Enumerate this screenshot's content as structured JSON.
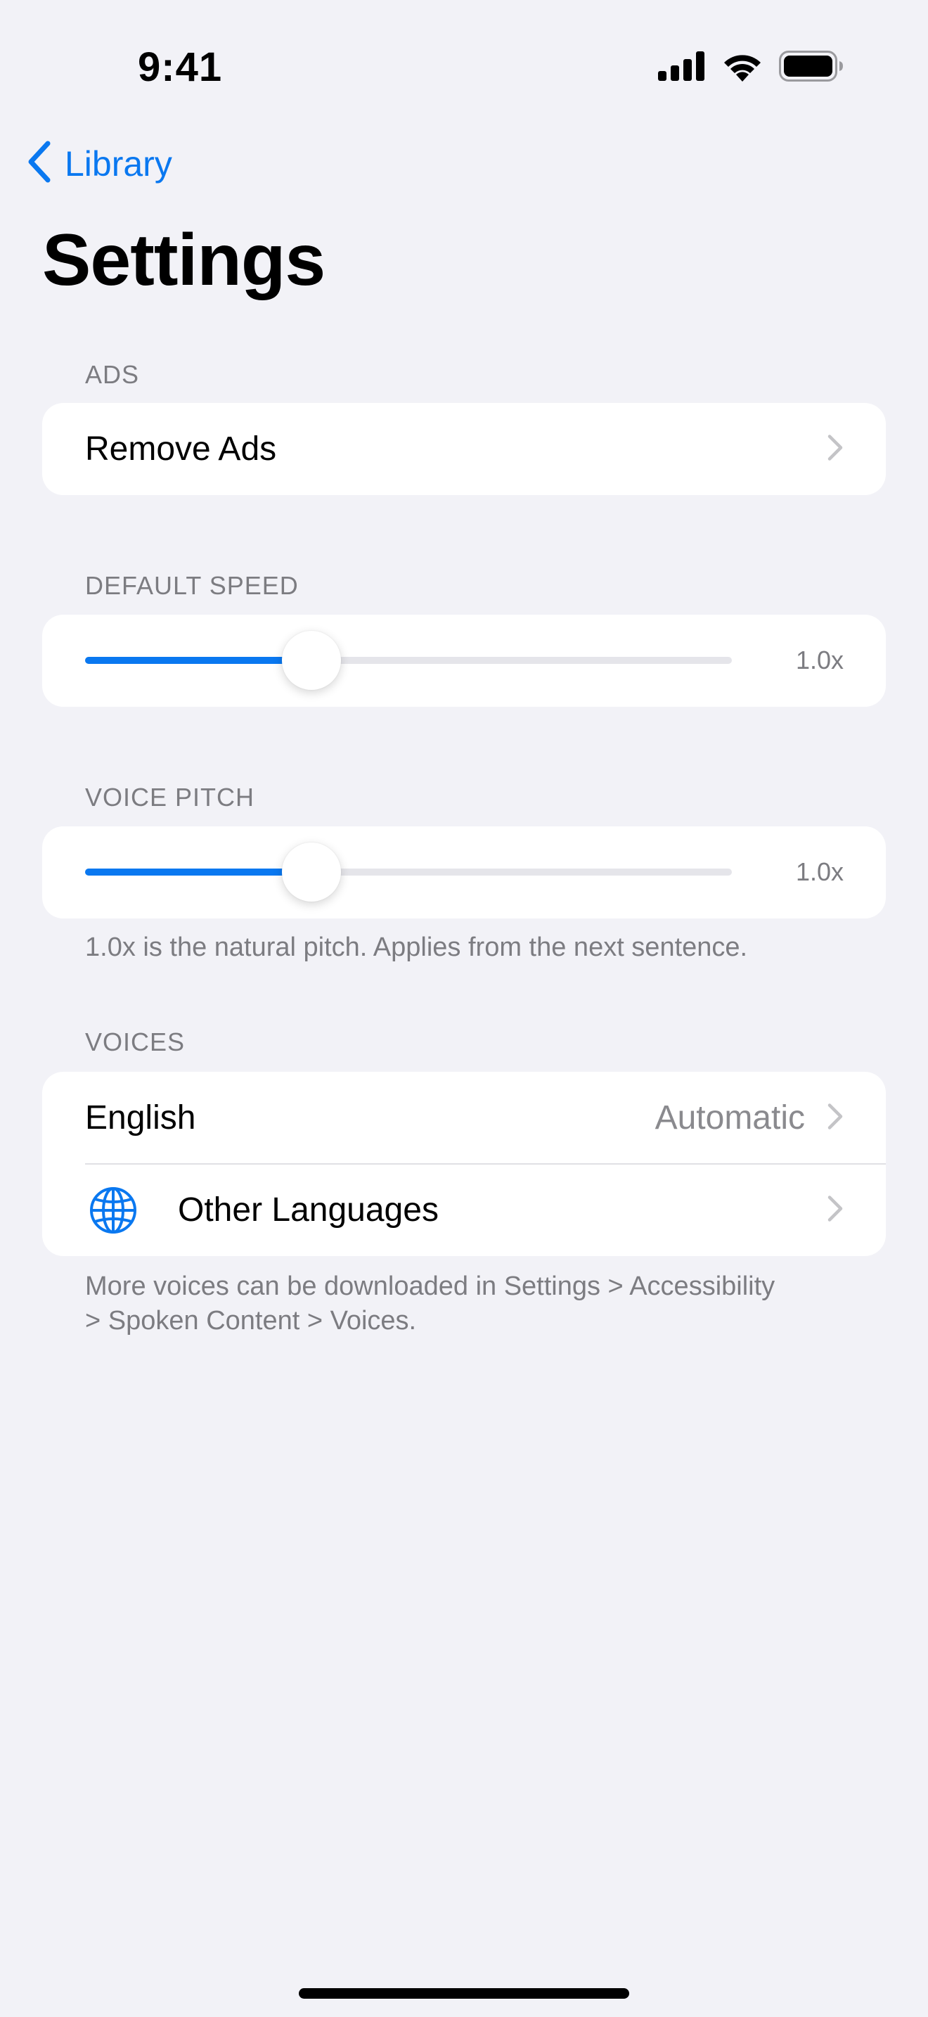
{
  "status_bar": {
    "time": "9:41",
    "icons": [
      "cellular-signal-icon",
      "wifi-icon",
      "battery-icon"
    ]
  },
  "nav": {
    "back_label": "Library",
    "back_icon": "chevron-left-icon"
  },
  "page_title": "Settings",
  "sections": {
    "ads": {
      "header": "ADS",
      "remove_ads_label": "Remove Ads"
    },
    "default_speed": {
      "header": "DEFAULT SPEED",
      "value_label": "1.0x",
      "slider_fraction": 0.35
    },
    "voice_pitch": {
      "header": "VOICE PITCH",
      "value_label": "1.0x",
      "slider_fraction": 0.35,
      "footnote": "1.0x is the natural pitch. Applies from the next sentence."
    },
    "voices": {
      "header": "VOICES",
      "english_label": "English",
      "english_value": "Automatic",
      "other_languages_label": "Other Languages",
      "other_languages_icon": "globe-icon",
      "footnote_line1": "More voices can be downloaded in Settings > Accessibility",
      "footnote_line2": "> Spoken Content > Voices."
    }
  },
  "colors": {
    "accent": "#0a78f0",
    "background": "#f2f2f7",
    "card": "#ffffff",
    "secondary_text": "#7c7c81"
  }
}
